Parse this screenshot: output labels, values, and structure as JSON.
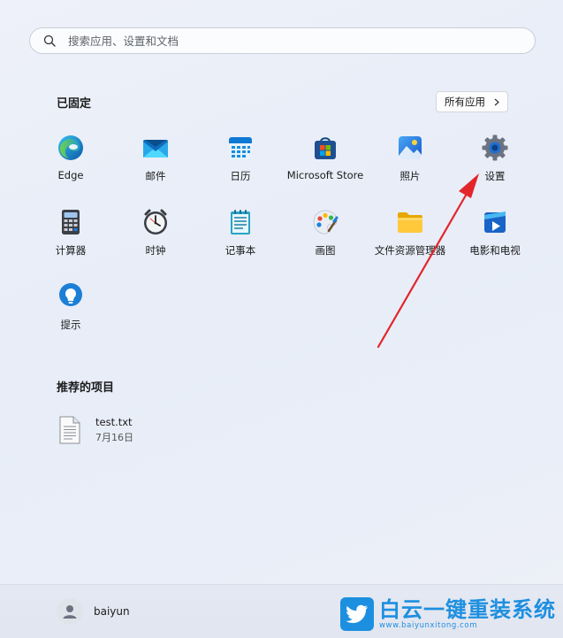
{
  "search": {
    "placeholder": "搜索应用、设置和文档"
  },
  "pinned": {
    "title": "已固定",
    "all_apps_label": "所有应用",
    "apps": [
      {
        "label": "Edge"
      },
      {
        "label": "邮件"
      },
      {
        "label": "日历"
      },
      {
        "label": "Microsoft Store"
      },
      {
        "label": "照片"
      },
      {
        "label": "设置"
      },
      {
        "label": "计算器"
      },
      {
        "label": "时钟"
      },
      {
        "label": "记事本"
      },
      {
        "label": "画图"
      },
      {
        "label": "文件资源管理器"
      },
      {
        "label": "电影和电视"
      },
      {
        "label": "提示"
      }
    ]
  },
  "recommended": {
    "title": "推荐的项目",
    "items": [
      {
        "name": "test.txt",
        "date": "7月16日"
      }
    ]
  },
  "user": {
    "name": "baiyun"
  },
  "watermark": {
    "title": "白云一键重装系统",
    "url": "www.baiyunxitong.com"
  },
  "colors": {
    "accent": "#1d8fe0",
    "arrow": "#e2262b"
  }
}
